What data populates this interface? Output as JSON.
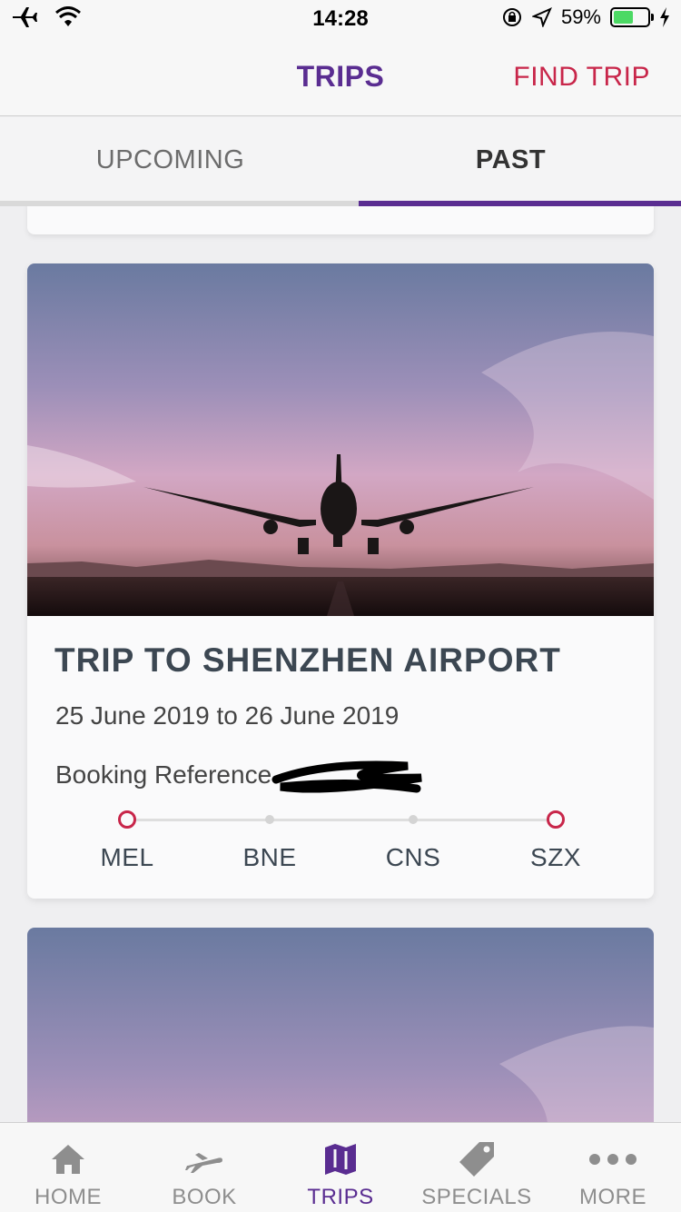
{
  "status_bar": {
    "time": "14:28",
    "battery_percent": "59%",
    "battery_level": 0.59
  },
  "nav": {
    "title": "TRIPS",
    "find_trip": "FIND TRIP"
  },
  "tabs": [
    {
      "label": "UPCOMING",
      "active": false
    },
    {
      "label": "PAST",
      "active": true
    }
  ],
  "trip": {
    "title": "TRIP TO SHENZHEN AIRPORT",
    "dates": "25 June 2019 to 26 June 2019",
    "booking_label": "Booking Reference",
    "stops": [
      "MEL",
      "BNE",
      "CNS",
      "SZX"
    ]
  },
  "tabbar": [
    {
      "label": "HOME",
      "icon": "home-icon",
      "active": false
    },
    {
      "label": "BOOK",
      "icon": "plane-icon",
      "active": false
    },
    {
      "label": "TRIPS",
      "icon": "map-icon",
      "active": true
    },
    {
      "label": "SPECIALS",
      "icon": "tag-icon",
      "active": false
    },
    {
      "label": "MORE",
      "icon": "more-icon",
      "active": false
    }
  ],
  "colors": {
    "brand_purple": "#5a2d91",
    "accent_red": "#c8264a",
    "battery_green": "#4cd964"
  }
}
